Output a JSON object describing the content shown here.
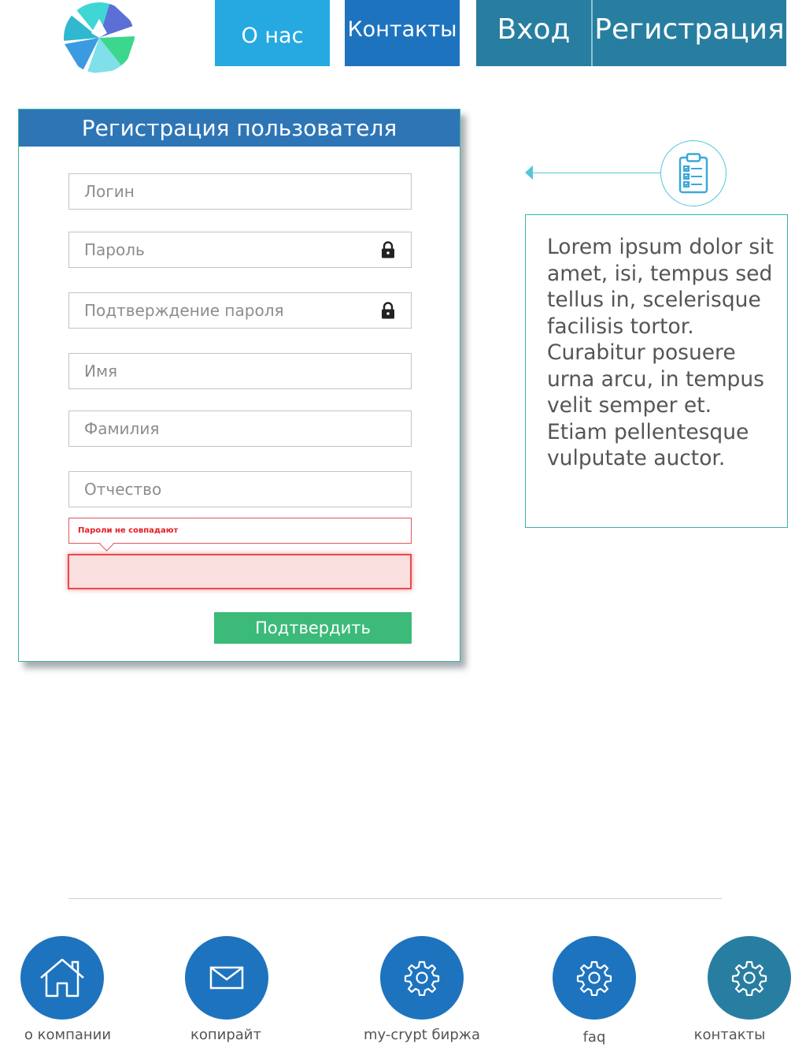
{
  "nav": {
    "about": "О нас",
    "contacts": "Контакты",
    "login": "Вход",
    "register": "Регистрация"
  },
  "registration": {
    "title": "Регистрация пользователя",
    "fields": {
      "login": "Логин",
      "password": "Пароль",
      "password_confirm": "Подтверждение пароля",
      "first_name": "Имя",
      "last_name": "Фамилия",
      "patronymic": "Отчество"
    },
    "error": "Пароли не совпадают",
    "submit": "Подтвердить"
  },
  "info": {
    "text": "Lorem ipsum dolor sit amet, isi, tempus sed tellus in, scelerisque facilisis tortor. Curabitur posuere urna arcu, in tempus velit semper et. Etiam pellentesque vulputate auctor."
  },
  "footer": {
    "items": [
      {
        "label": "о компании",
        "icon": "home-icon",
        "color": "#1e73be"
      },
      {
        "label": "копирайт",
        "icon": "envelope-icon",
        "color": "#1e73be"
      },
      {
        "label": "my-crypt биржа",
        "icon": "gear-icon",
        "color": "#1e73be"
      },
      {
        "label": "faq",
        "icon": "gear-icon",
        "color": "#1e73be"
      },
      {
        "label": "контакты",
        "icon": "gear-icon",
        "color": "#287ea0"
      }
    ]
  },
  "colors": {
    "nav_about": "#26a9e0",
    "nav_contacts": "#1e73be",
    "nav_login_register": "#287ea0",
    "header_blue": "#2e75b6",
    "submit_green": "#3cba79",
    "error_red": "#e31b23",
    "teal_border": "#39b5a5"
  }
}
